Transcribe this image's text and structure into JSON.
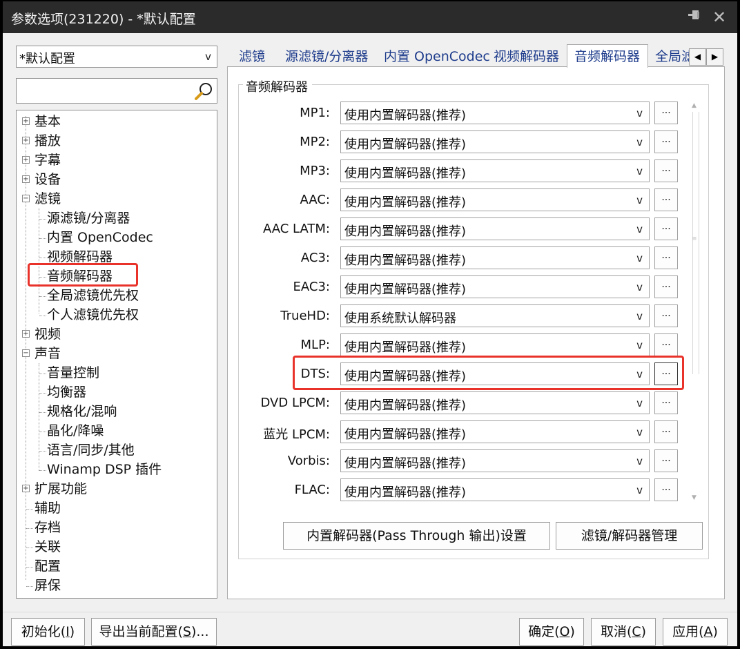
{
  "window": {
    "title": "参数选项(231220) - *默认配置",
    "pin_icon": "pin-icon",
    "close_icon": "close-icon"
  },
  "profile": {
    "selected": "*默认配置"
  },
  "search": {
    "value": "",
    "icon": "magnifier-icon"
  },
  "tree": {
    "items": [
      {
        "label": "基本",
        "level": 0,
        "expander": "+"
      },
      {
        "label": "播放",
        "level": 0,
        "expander": "+"
      },
      {
        "label": "字幕",
        "level": 0,
        "expander": "+"
      },
      {
        "label": "设备",
        "level": 0,
        "expander": "+"
      },
      {
        "label": "滤镜",
        "level": 0,
        "expander": "-"
      },
      {
        "label": "源滤镜/分离器",
        "level": 1
      },
      {
        "label": "内置 OpenCodec",
        "level": 1
      },
      {
        "label": "视频解码器",
        "level": 1
      },
      {
        "label": "音频解码器",
        "level": 1,
        "selected": true
      },
      {
        "label": "全局滤镜优先权",
        "level": 1
      },
      {
        "label": "个人滤镜优先权",
        "level": 1
      },
      {
        "label": "视频",
        "level": 0,
        "expander": "+"
      },
      {
        "label": "声音",
        "level": 0,
        "expander": "-"
      },
      {
        "label": "音量控制",
        "level": 1
      },
      {
        "label": "均衡器",
        "level": 1
      },
      {
        "label": "规格化/混响",
        "level": 1
      },
      {
        "label": "晶化/降噪",
        "level": 1
      },
      {
        "label": "语言/同步/其他",
        "level": 1
      },
      {
        "label": "Winamp DSP 插件",
        "level": 1
      },
      {
        "label": "扩展功能",
        "level": 0,
        "expander": "+"
      },
      {
        "label": "辅助",
        "level": 0
      },
      {
        "label": "存档",
        "level": 0
      },
      {
        "label": "关联",
        "level": 0
      },
      {
        "label": "配置",
        "level": 0
      },
      {
        "label": "屏保",
        "level": 0
      }
    ]
  },
  "tabs": [
    {
      "label": "滤镜"
    },
    {
      "label": "源滤镜/分离器"
    },
    {
      "label": "内置 OpenCodec"
    },
    {
      "label": "视频解码器"
    },
    {
      "label": "音频解码器",
      "active": true
    },
    {
      "label": "全局滤"
    }
  ],
  "group": {
    "title": "音频解码器",
    "rows": [
      {
        "label": "MP1:",
        "value": "使用内置解码器(推荐)"
      },
      {
        "label": "MP2:",
        "value": "使用内置解码器(推荐)"
      },
      {
        "label": "MP3:",
        "value": "使用内置解码器(推荐)"
      },
      {
        "label": "AAC:",
        "value": "使用内置解码器(推荐)"
      },
      {
        "label": "AAC LATM:",
        "value": "使用内置解码器(推荐)"
      },
      {
        "label": "AC3:",
        "value": "使用内置解码器(推荐)"
      },
      {
        "label": "EAC3:",
        "value": "使用内置解码器(推荐)"
      },
      {
        "label": "TrueHD:",
        "value": "使用系统默认解码器"
      },
      {
        "label": "MLP:",
        "value": "使用内置解码器(推荐)"
      },
      {
        "label": "DTS:",
        "value": "使用内置解码器(推荐)",
        "highlighted": true
      },
      {
        "label": "DVD LPCM:",
        "value": "使用内置解码器(推荐)"
      },
      {
        "label": "蓝光 LPCM:",
        "value": "使用内置解码器(推荐)"
      },
      {
        "label": "Vorbis:",
        "value": "使用内置解码器(推荐)"
      },
      {
        "label": "FLAC:",
        "value": "使用内置解码器(推荐)"
      }
    ],
    "dots_label": "...",
    "passthrough_button": "内置解码器(Pass Through 输出)设置",
    "manage_button": "滤镜/解码器管理"
  },
  "footer": {
    "init": {
      "text": "初始化(",
      "key": "I",
      "end": ")"
    },
    "export": {
      "text": "导出当前配置(",
      "key": "S",
      "end": ")..."
    },
    "ok": {
      "text": "确定(",
      "key": "O",
      "end": ")"
    },
    "cancel": {
      "text": "取消(",
      "key": "C",
      "end": ")"
    },
    "apply": {
      "text": "应用(",
      "key": "A",
      "end": ")"
    }
  },
  "colors": {
    "highlight": "#e8322a",
    "tab_text": "#1e3c8c",
    "titlebar": "#2b2b2b"
  }
}
